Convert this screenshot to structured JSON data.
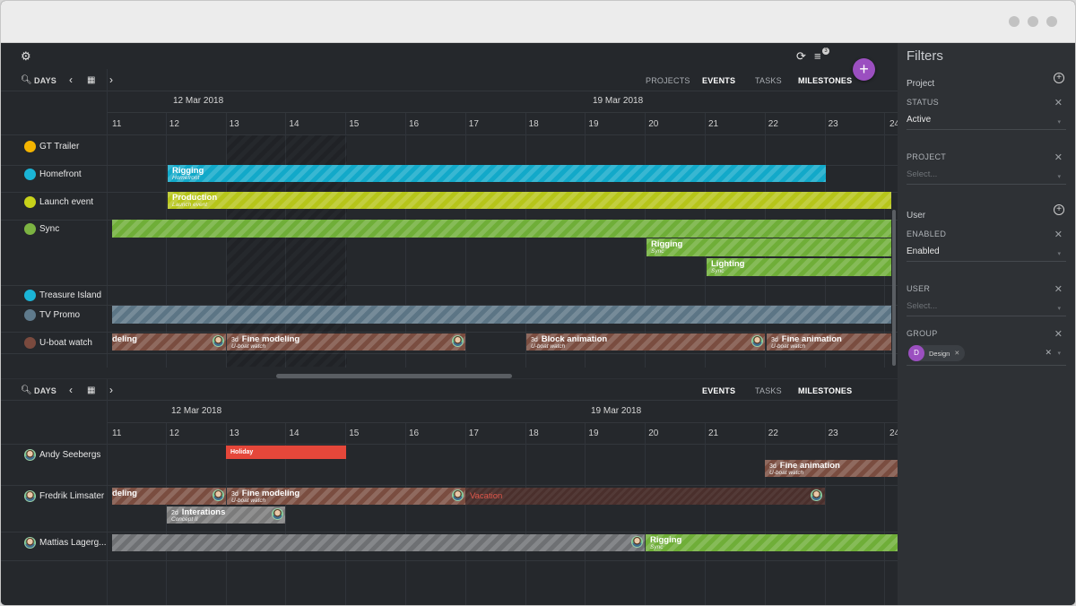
{
  "window": {
    "title": ""
  },
  "toolbar": {
    "filter_badge": "3",
    "add_label": "+"
  },
  "top_panel": {
    "zoom_label": "DAYS",
    "tabs": [
      {
        "label": "PROJECTS",
        "active": false
      },
      {
        "label": "EVENTS",
        "active": true
      },
      {
        "label": "TASKS",
        "active": false
      },
      {
        "label": "MILESTONES",
        "active": true
      }
    ],
    "week_labels": [
      "12 Mar 2018",
      "19 Mar 2018"
    ],
    "days": [
      "11",
      "12",
      "13",
      "14",
      "15",
      "16",
      "17",
      "18",
      "19",
      "20",
      "21",
      "22",
      "23",
      "24"
    ],
    "rows": [
      {
        "label": "GT Trailer",
        "color": "#f4b400"
      },
      {
        "label": "Homefront",
        "color": "#1ab4d6"
      },
      {
        "label": "Launch event",
        "color": "#c8d21a"
      },
      {
        "label": "Sync",
        "color": "#7cb342"
      },
      {
        "label": "Treasure Island",
        "color": "#1ab4d6"
      },
      {
        "label": "TV Promo",
        "color": "#5f7a8c"
      },
      {
        "label": "U-boat watch",
        "color": "#7a4a3e"
      }
    ],
    "bars": [
      {
        "title": "Rigging",
        "subtitle": "Homefront",
        "duration": "",
        "color": "#12a9c9"
      },
      {
        "title": "Production",
        "subtitle": "Launch event",
        "duration": "",
        "color": "#b6c51a"
      },
      {
        "title": "",
        "subtitle": "",
        "duration": "",
        "color": "#6fae38"
      },
      {
        "title": "Rigging",
        "subtitle": "Sync",
        "duration": "",
        "color": "#6fae38"
      },
      {
        "title": "Lighting",
        "subtitle": "Sync",
        "duration": "",
        "color": "#6fae38"
      },
      {
        "title": "",
        "subtitle": "",
        "duration": "",
        "color": "#5c7585"
      },
      {
        "title": "deling",
        "subtitle": "",
        "duration": "",
        "color": "#7a4d40"
      },
      {
        "title": "Fine modeling",
        "subtitle": "U-boat watch",
        "duration": "3d",
        "color": "#7a4d40"
      },
      {
        "title": "Block animation",
        "subtitle": "U-boat watch",
        "duration": "3d",
        "color": "#7a4d40"
      },
      {
        "title": "Fine animation",
        "subtitle": "U-boat watch",
        "duration": "3d",
        "color": "#7a4d40"
      }
    ]
  },
  "bottom_panel": {
    "zoom_label": "DAYS",
    "tabs": [
      {
        "label": "EVENTS",
        "active": true
      },
      {
        "label": "TASKS",
        "active": false
      },
      {
        "label": "MILESTONES",
        "active": true
      }
    ],
    "week_labels": [
      "12 Mar 2018",
      "19 Mar 2018"
    ],
    "days": [
      "11",
      "12",
      "13",
      "14",
      "15",
      "16",
      "17",
      "18",
      "19",
      "20",
      "21",
      "22",
      "23",
      "24"
    ],
    "rows": [
      {
        "label": "Andy Seebergs"
      },
      {
        "label": "Fredrik Limsater"
      },
      {
        "label": "Mattias Lagerg..."
      }
    ],
    "bars": [
      {
        "title": "Holiday",
        "subtitle": "",
        "duration": "",
        "color": "#e5473a"
      },
      {
        "title": "Fine animation",
        "subtitle": "U-boat watch",
        "duration": "3d",
        "color": "#7a4d40"
      },
      {
        "title": "deling",
        "subtitle": "",
        "duration": "",
        "color": "#7a4d40"
      },
      {
        "title": "Fine modeling",
        "subtitle": "U-boat watch",
        "duration": "3d",
        "color": "#7a4d40"
      },
      {
        "title": "Vacation",
        "subtitle": "",
        "duration": "",
        "color": "#4a2f2c"
      },
      {
        "title": "Interations",
        "subtitle": "Concept II",
        "duration": "2d",
        "color": "#7b7b7b"
      },
      {
        "title": "",
        "subtitle": "",
        "duration": "",
        "color": "#6e7073"
      },
      {
        "title": "Rigging",
        "subtitle": "Sync",
        "duration": "",
        "color": "#6fae38"
      }
    ]
  },
  "filters": {
    "title": "Filters",
    "project_heading": "Project",
    "status_label": "STATUS",
    "status_value": "Active",
    "project_label": "PROJECT",
    "project_placeholder": "Select...",
    "user_heading": "User",
    "enabled_label": "ENABLED",
    "enabled_value": "Enabled",
    "user_label": "USER",
    "user_placeholder": "Select...",
    "group_label": "GROUP",
    "group_chip_initial": "D",
    "group_chip_label": "Design",
    "accent": "#9b4fc0"
  }
}
